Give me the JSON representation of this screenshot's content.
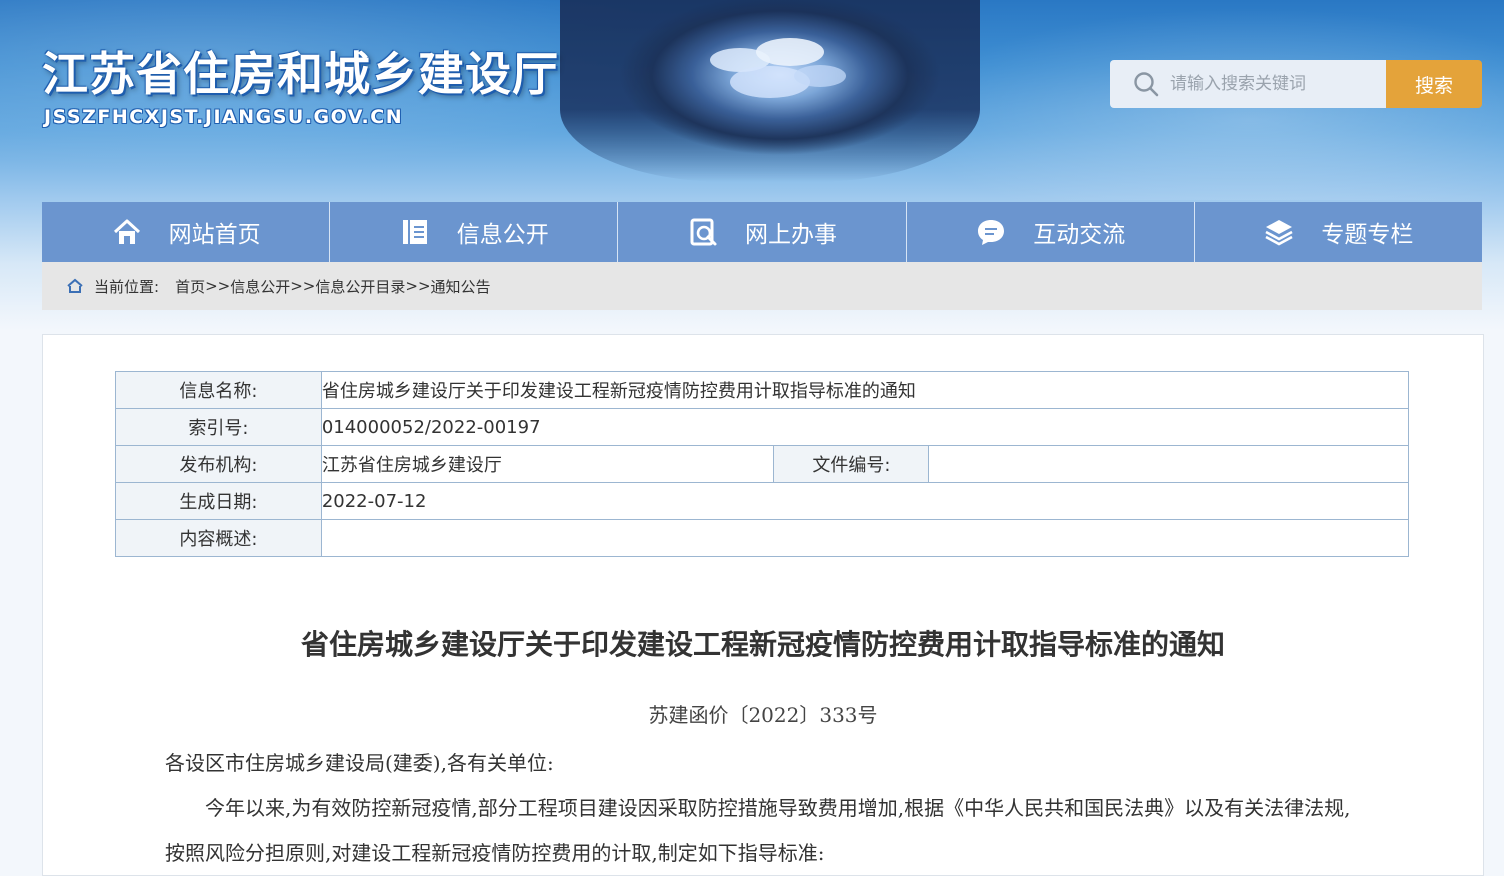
{
  "header": {
    "site_title": "江苏省住房和城乡建设厅",
    "site_url": "JSSZFHCXJST.JIANGSU.GOV.CN",
    "search": {
      "placeholder": "请输入搜索关键词",
      "button_label": "搜索"
    }
  },
  "nav": {
    "items": [
      {
        "label": "网站首页",
        "icon": "home-icon"
      },
      {
        "label": "信息公开",
        "icon": "document-icon"
      },
      {
        "label": "网上办事",
        "icon": "service-icon"
      },
      {
        "label": "互动交流",
        "icon": "chat-icon"
      },
      {
        "label": "专题专栏",
        "icon": "layers-icon"
      }
    ]
  },
  "breadcrumb": {
    "prefix": "当前位置:",
    "items": [
      "首页",
      "信息公开",
      "信息公开目录",
      "通知公告"
    ],
    "separator": ">>"
  },
  "meta": {
    "name_label": "信息名称:",
    "name_value": "省住房城乡建设厅关于印发建设工程新冠疫情防控费用计取指导标准的通知",
    "index_label": "索引号:",
    "index_value": "014000052/2022-00197",
    "publisher_label": "发布机构:",
    "publisher_value": "江苏省住房城乡建设厅",
    "docno_label": "文件编号:",
    "docno_value": "",
    "date_label": "生成日期:",
    "date_value": "2022-07-12",
    "summary_label": "内容概述:",
    "summary_value": ""
  },
  "document": {
    "title": "省住房城乡建设厅关于印发建设工程新冠疫情防控费用计取指导标准的通知",
    "number": "苏建函价〔2022〕333号",
    "salutation": "各设区市住房城乡建设局(建委),各有关单位:",
    "paragraph1": "今年以来,为有效防控新冠疫情,部分工程项目建设因采取防控措施导致费用增加,根据《中华人民共和国民法典》以及有关法律法规,按照风险分担原则,对建设工程新冠疫情防控费用的计取,制定如下指导标准:"
  },
  "colors": {
    "nav_bg": "#6b95cf",
    "search_button": "#e4a33a",
    "breadcrumb_bg": "#e6e6e6",
    "table_border": "#9cb6d1"
  }
}
